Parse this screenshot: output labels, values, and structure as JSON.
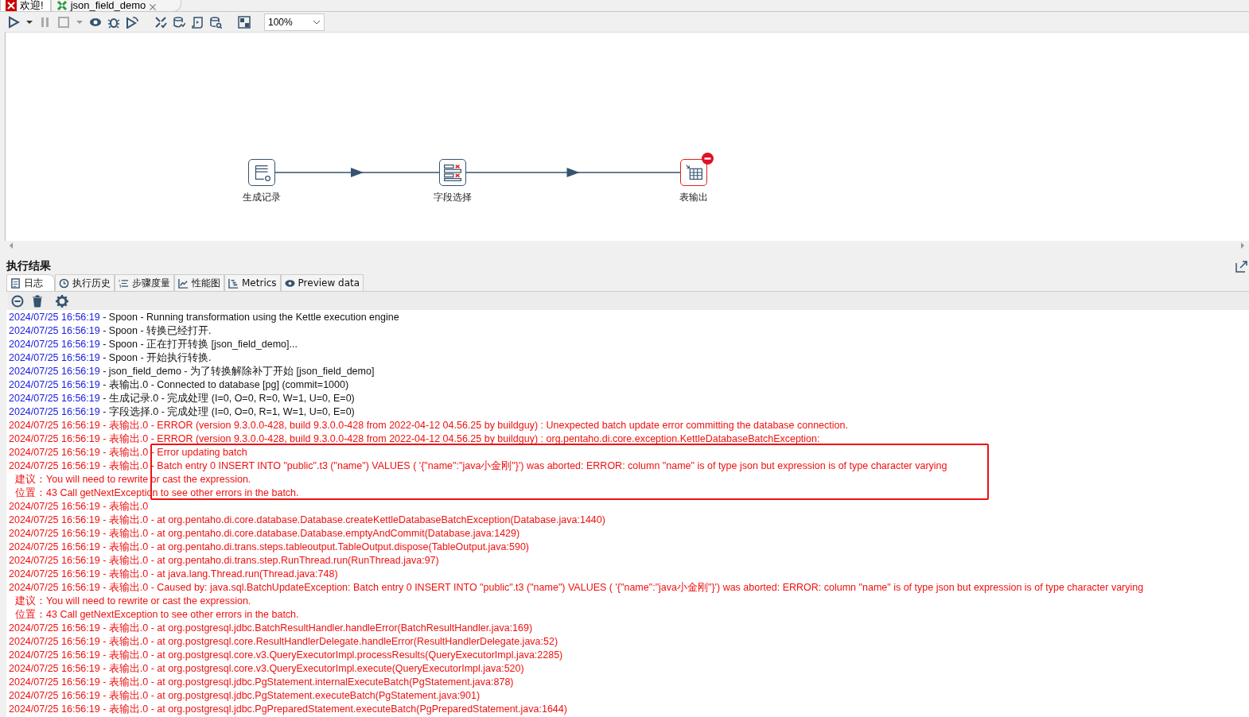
{
  "editor_tabs": [
    {
      "label": "欢迎!",
      "kind": "welcome",
      "selected": false,
      "closable": false
    },
    {
      "label": "json_field_demo",
      "kind": "transformation",
      "selected": true,
      "closable": true
    }
  ],
  "toolbar": {
    "zoom": "100%"
  },
  "canvas": {
    "steps": [
      {
        "label": "生成记录",
        "kind": "generate",
        "error": false
      },
      {
        "label": "字段选择",
        "kind": "select",
        "error": false
      },
      {
        "label": "表输出",
        "kind": "table",
        "error": true
      }
    ]
  },
  "results": {
    "title": "执行结果",
    "tabs": [
      {
        "label": "日志",
        "kind": "log",
        "selected": true
      },
      {
        "label": "执行历史",
        "kind": "history",
        "selected": false
      },
      {
        "label": "步骤度量",
        "kind": "metrics-list",
        "selected": false
      },
      {
        "label": "性能图",
        "kind": "chart",
        "selected": false
      },
      {
        "label": "Metrics",
        "kind": "gantt",
        "selected": false
      },
      {
        "label": "Preview data",
        "kind": "preview",
        "selected": false
      }
    ],
    "log": [
      {
        "kind": "info",
        "time": "2024/07/25 16:56:19",
        "text": " - Spoon - Running transformation using the Kettle execution engine"
      },
      {
        "kind": "info",
        "time": "2024/07/25 16:56:19",
        "text": " - Spoon - 转换已经打开."
      },
      {
        "kind": "info",
        "time": "2024/07/25 16:56:19",
        "text": " - Spoon - 正在打开转换 [json_field_demo]..."
      },
      {
        "kind": "info",
        "time": "2024/07/25 16:56:19",
        "text": " - Spoon - 开始执行转换."
      },
      {
        "kind": "info",
        "time": "2024/07/25 16:56:19",
        "text": " - json_field_demo - 为了转换解除补丁开始  [json_field_demo]"
      },
      {
        "kind": "info",
        "time": "2024/07/25 16:56:19",
        "text": " - 表输出.0 - Connected to database [pg] (commit=1000)"
      },
      {
        "kind": "info",
        "time": "2024/07/25 16:56:19",
        "text": " - 生成记录.0 - 完成处理 (I=0, O=0, R=0, W=1, U=0, E=0)"
      },
      {
        "kind": "info",
        "time": "2024/07/25 16:56:19",
        "text": " - 字段选择.0 - 完成处理 (I=0, O=0, R=1, W=1, U=0, E=0)"
      },
      {
        "kind": "error",
        "time": "2024/07/25 16:56:19",
        "text": " - 表输出.0 - ERROR (version 9.3.0.0-428, build 9.3.0.0-428 from 2022-04-12 04.56.25 by buildguy) : Unexpected batch update error committing the database connection."
      },
      {
        "kind": "error",
        "time": "2024/07/25 16:56:19",
        "text": " - 表输出.0 - ERROR (version 9.3.0.0-428, build 9.3.0.0-428 from 2022-04-12 04.56.25 by buildguy) : org.pentaho.di.core.exception.KettleDatabaseBatchException:"
      },
      {
        "kind": "error",
        "time": "2024/07/25 16:56:19",
        "text": " - 表输出.0 - Error updating batch"
      },
      {
        "kind": "error",
        "time": "2024/07/25 16:56:19",
        "text": " - 表输出.0 - Batch entry 0 INSERT INTO \"public\".t3 (\"name\") VALUES ( '{\"name\":\"java小金刚\"}') was aborted: ERROR: column \"name\" is of type json but expression is of type character varying"
      },
      {
        "kind": "continuation",
        "text": "建议：You will need to rewrite or cast the expression."
      },
      {
        "kind": "continuation",
        "text": "位置：43  Call getNextException to see other errors in the batch."
      },
      {
        "kind": "error",
        "time": "2024/07/25 16:56:19",
        "text": " - 表输出.0"
      },
      {
        "kind": "error",
        "time": "2024/07/25 16:56:19",
        "text": " - 表输出.0 -  at org.pentaho.di.core.database.Database.createKettleDatabaseBatchException(Database.java:1440)"
      },
      {
        "kind": "error",
        "time": "2024/07/25 16:56:19",
        "text": " - 表输出.0 -  at org.pentaho.di.core.database.Database.emptyAndCommit(Database.java:1429)"
      },
      {
        "kind": "error",
        "time": "2024/07/25 16:56:19",
        "text": " - 表输出.0 -  at org.pentaho.di.trans.steps.tableoutput.TableOutput.dispose(TableOutput.java:590)"
      },
      {
        "kind": "error",
        "time": "2024/07/25 16:56:19",
        "text": " - 表输出.0 -  at org.pentaho.di.trans.step.RunThread.run(RunThread.java:97)"
      },
      {
        "kind": "error",
        "time": "2024/07/25 16:56:19",
        "text": " - 表输出.0 -  at java.lang.Thread.run(Thread.java:748)"
      },
      {
        "kind": "error",
        "time": "2024/07/25 16:56:19",
        "text": " - 表输出.0 - Caused by: java.sql.BatchUpdateException: Batch entry 0 INSERT INTO \"public\".t3 (\"name\") VALUES ( '{\"name\":\"java小金刚\"}') was aborted: ERROR: column \"name\" is of type json but expression is of type character varying"
      },
      {
        "kind": "continuation",
        "text": "建议：You will need to rewrite or cast the expression."
      },
      {
        "kind": "continuation",
        "text": "位置：43  Call getNextException to see other errors in the batch."
      },
      {
        "kind": "error",
        "time": "2024/07/25 16:56:19",
        "text": " - 表输出.0 -  at org.postgresql.jdbc.BatchResultHandler.handleError(BatchResultHandler.java:169)"
      },
      {
        "kind": "error",
        "time": "2024/07/25 16:56:19",
        "text": " - 表输出.0 -  at org.postgresql.core.ResultHandlerDelegate.handleError(ResultHandlerDelegate.java:52)"
      },
      {
        "kind": "error",
        "time": "2024/07/25 16:56:19",
        "text": " - 表输出.0 -  at org.postgresql.core.v3.QueryExecutorImpl.processResults(QueryExecutorImpl.java:2285)"
      },
      {
        "kind": "error",
        "time": "2024/07/25 16:56:19",
        "text": " - 表输出.0 -  at org.postgresql.core.v3.QueryExecutorImpl.execute(QueryExecutorImpl.java:520)"
      },
      {
        "kind": "error",
        "time": "2024/07/25 16:56:19",
        "text": " - 表输出.0 -  at org.postgresql.jdbc.PgStatement.internalExecuteBatch(PgStatement.java:878)"
      },
      {
        "kind": "error",
        "time": "2024/07/25 16:56:19",
        "text": " - 表输出.0 -  at org.postgresql.jdbc.PgStatement.executeBatch(PgStatement.java:901)"
      },
      {
        "kind": "error",
        "time": "2024/07/25 16:56:19",
        "text": " - 表输出.0 -  at org.postgresql.jdbc.PgPreparedStatement.executeBatch(PgPreparedStatement.java:1644)"
      }
    ]
  }
}
